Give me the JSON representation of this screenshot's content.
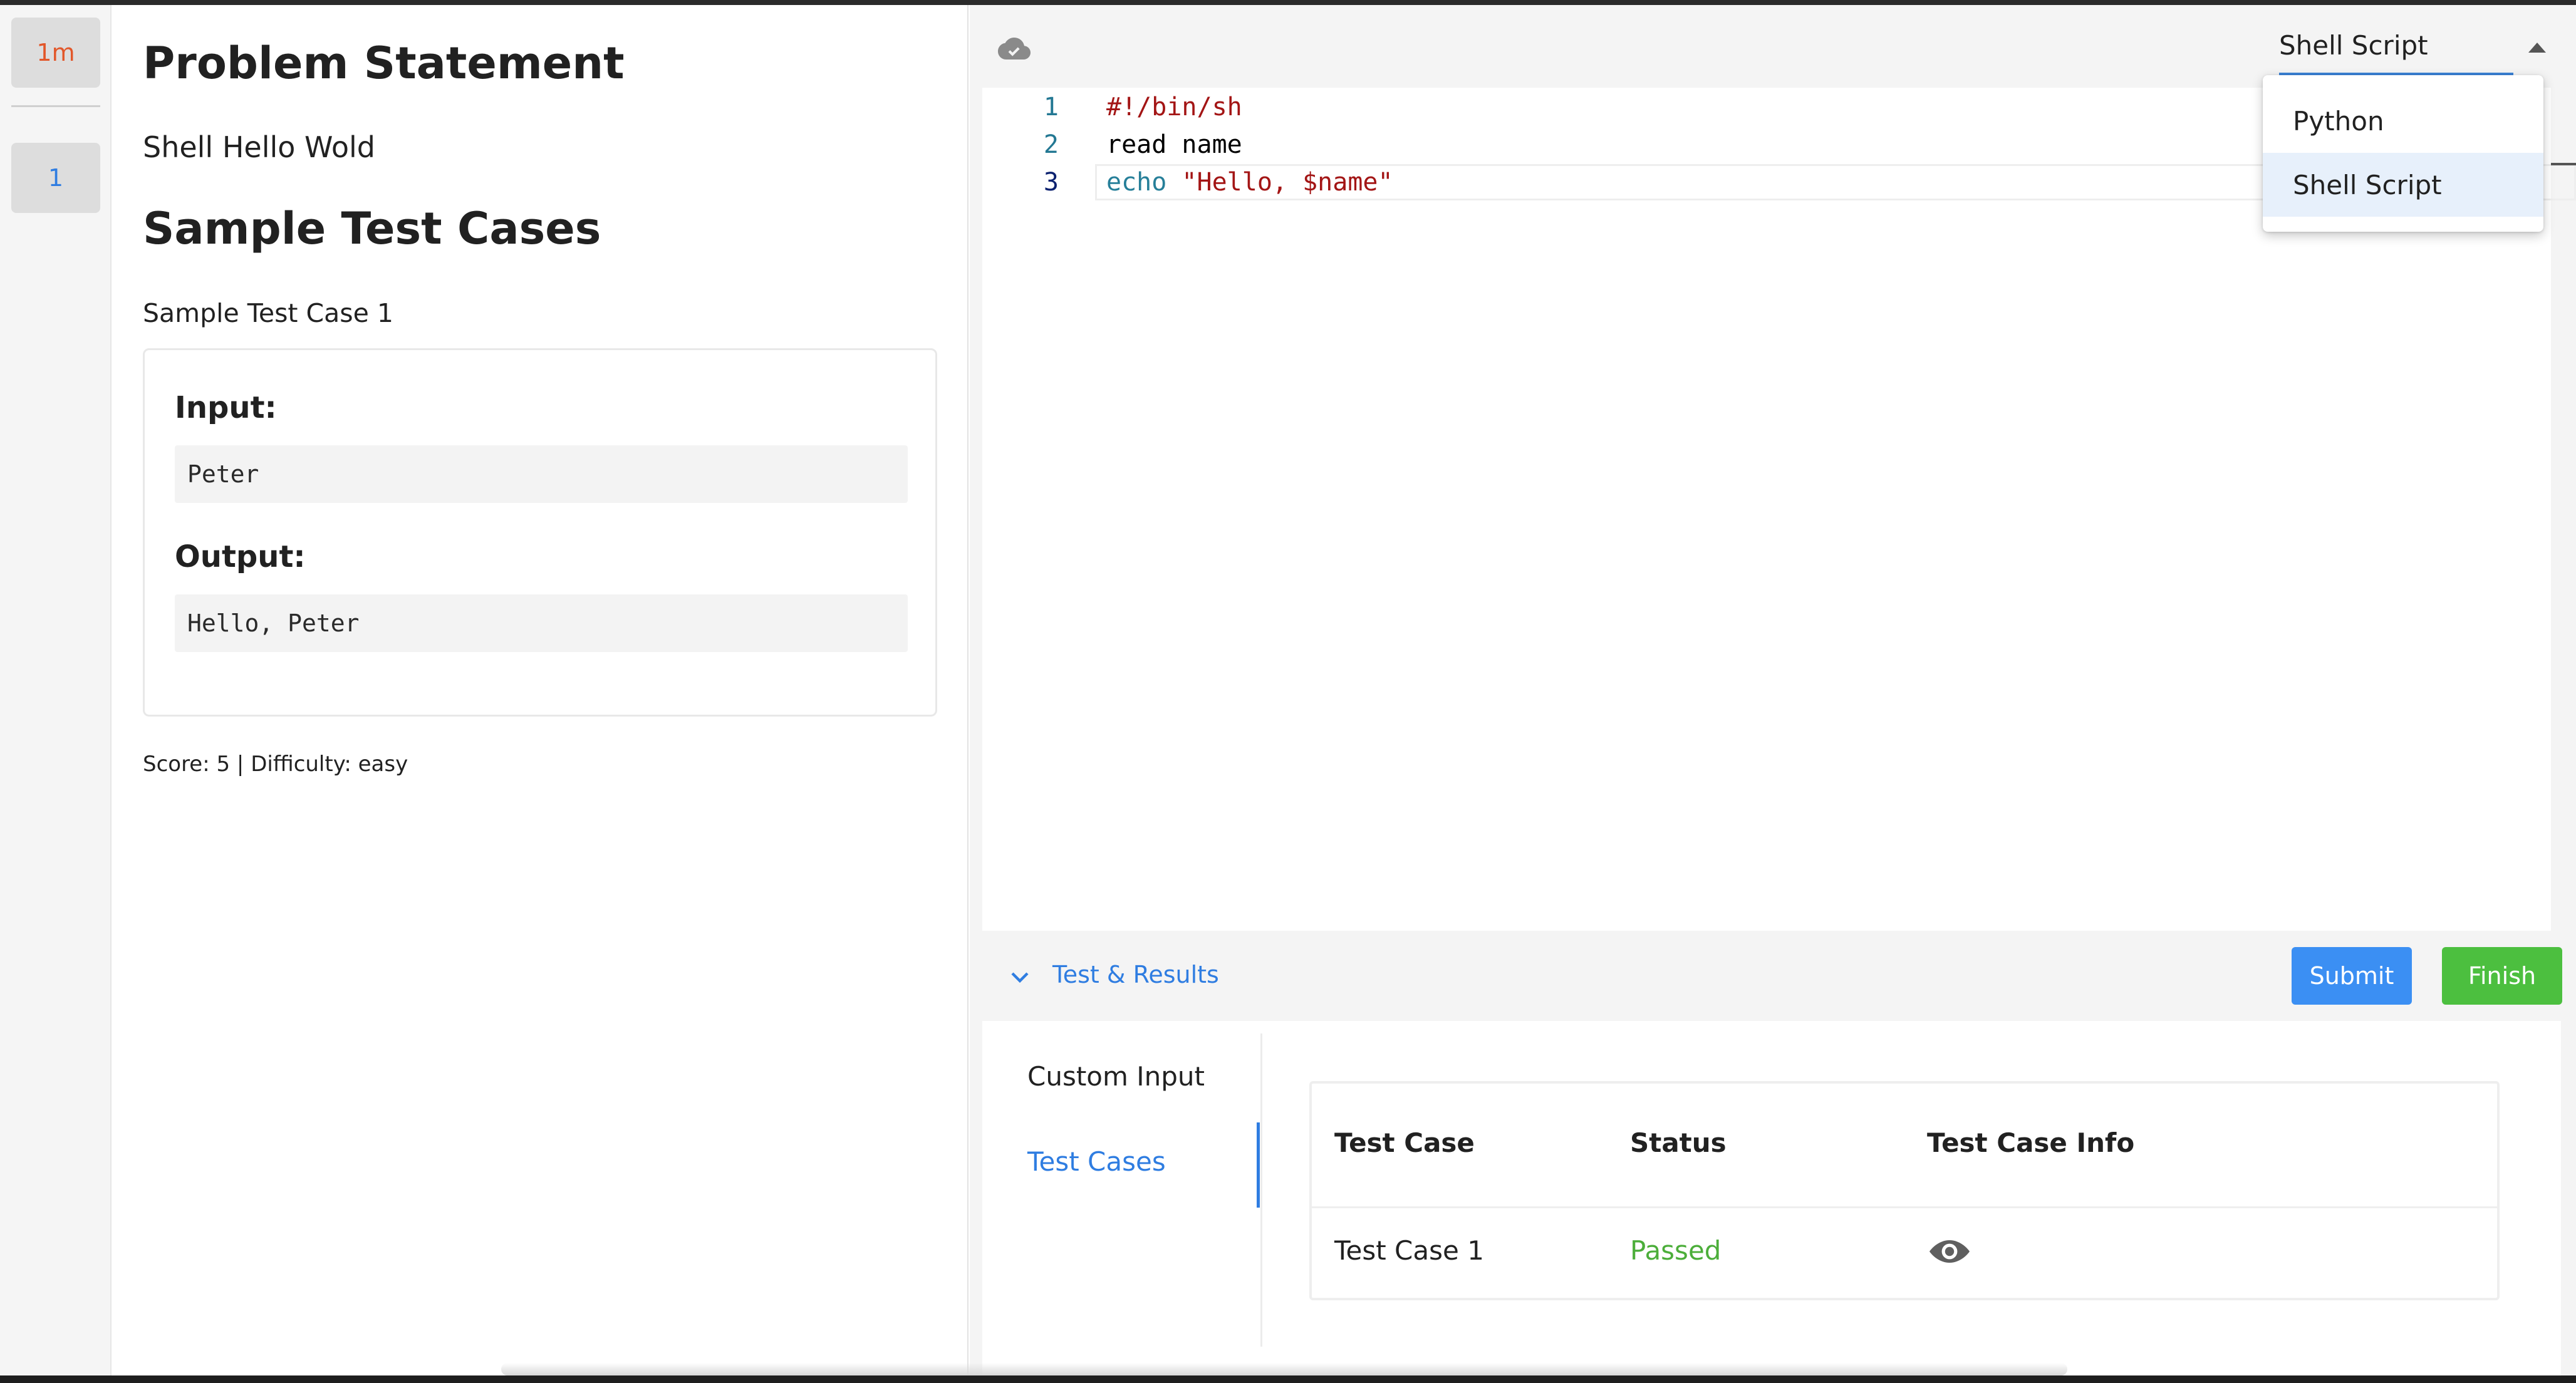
{
  "rail": {
    "timer_label": "1m",
    "question_number": "1"
  },
  "problem": {
    "title": "Problem Statement",
    "description": "Shell Hello Wold",
    "sample_title": "Sample Test Cases",
    "sample_case_label": "Sample Test Case 1",
    "input_label": "Input:",
    "input_value": "Peter",
    "output_label": "Output:",
    "output_value": "Hello, Peter",
    "meta": "Score: 5 | Difficulty: easy"
  },
  "editor": {
    "lines": [
      {
        "number": "1",
        "code": "#!/bin/sh"
      },
      {
        "number": "2",
        "code": "read name"
      },
      {
        "number": "3",
        "keyword": "echo",
        "string": "\"Hello, $name\""
      }
    ]
  },
  "language": {
    "selected": "Shell Script",
    "options": [
      "Python",
      "Shell Script"
    ]
  },
  "results": {
    "title": "Test & Results",
    "submit_label": "Submit",
    "finish_label": "Finish",
    "tabs": [
      "Custom Input",
      "Test Cases"
    ],
    "table": {
      "headers": [
        "Test Case",
        "Status",
        "Test Case Info"
      ],
      "rows": [
        {
          "name": "Test Case 1",
          "status": "Passed",
          "info_icon": "eye-icon"
        }
      ]
    }
  },
  "icons": {
    "cloud": "cloud-done-icon",
    "chevron": "chevron-down-icon"
  },
  "colors": {
    "accent": "#2f7de1",
    "submit": "#3b8ff3",
    "finish": "#4cbf3f",
    "timer": "#e2572a",
    "passed": "#4cae3a"
  }
}
